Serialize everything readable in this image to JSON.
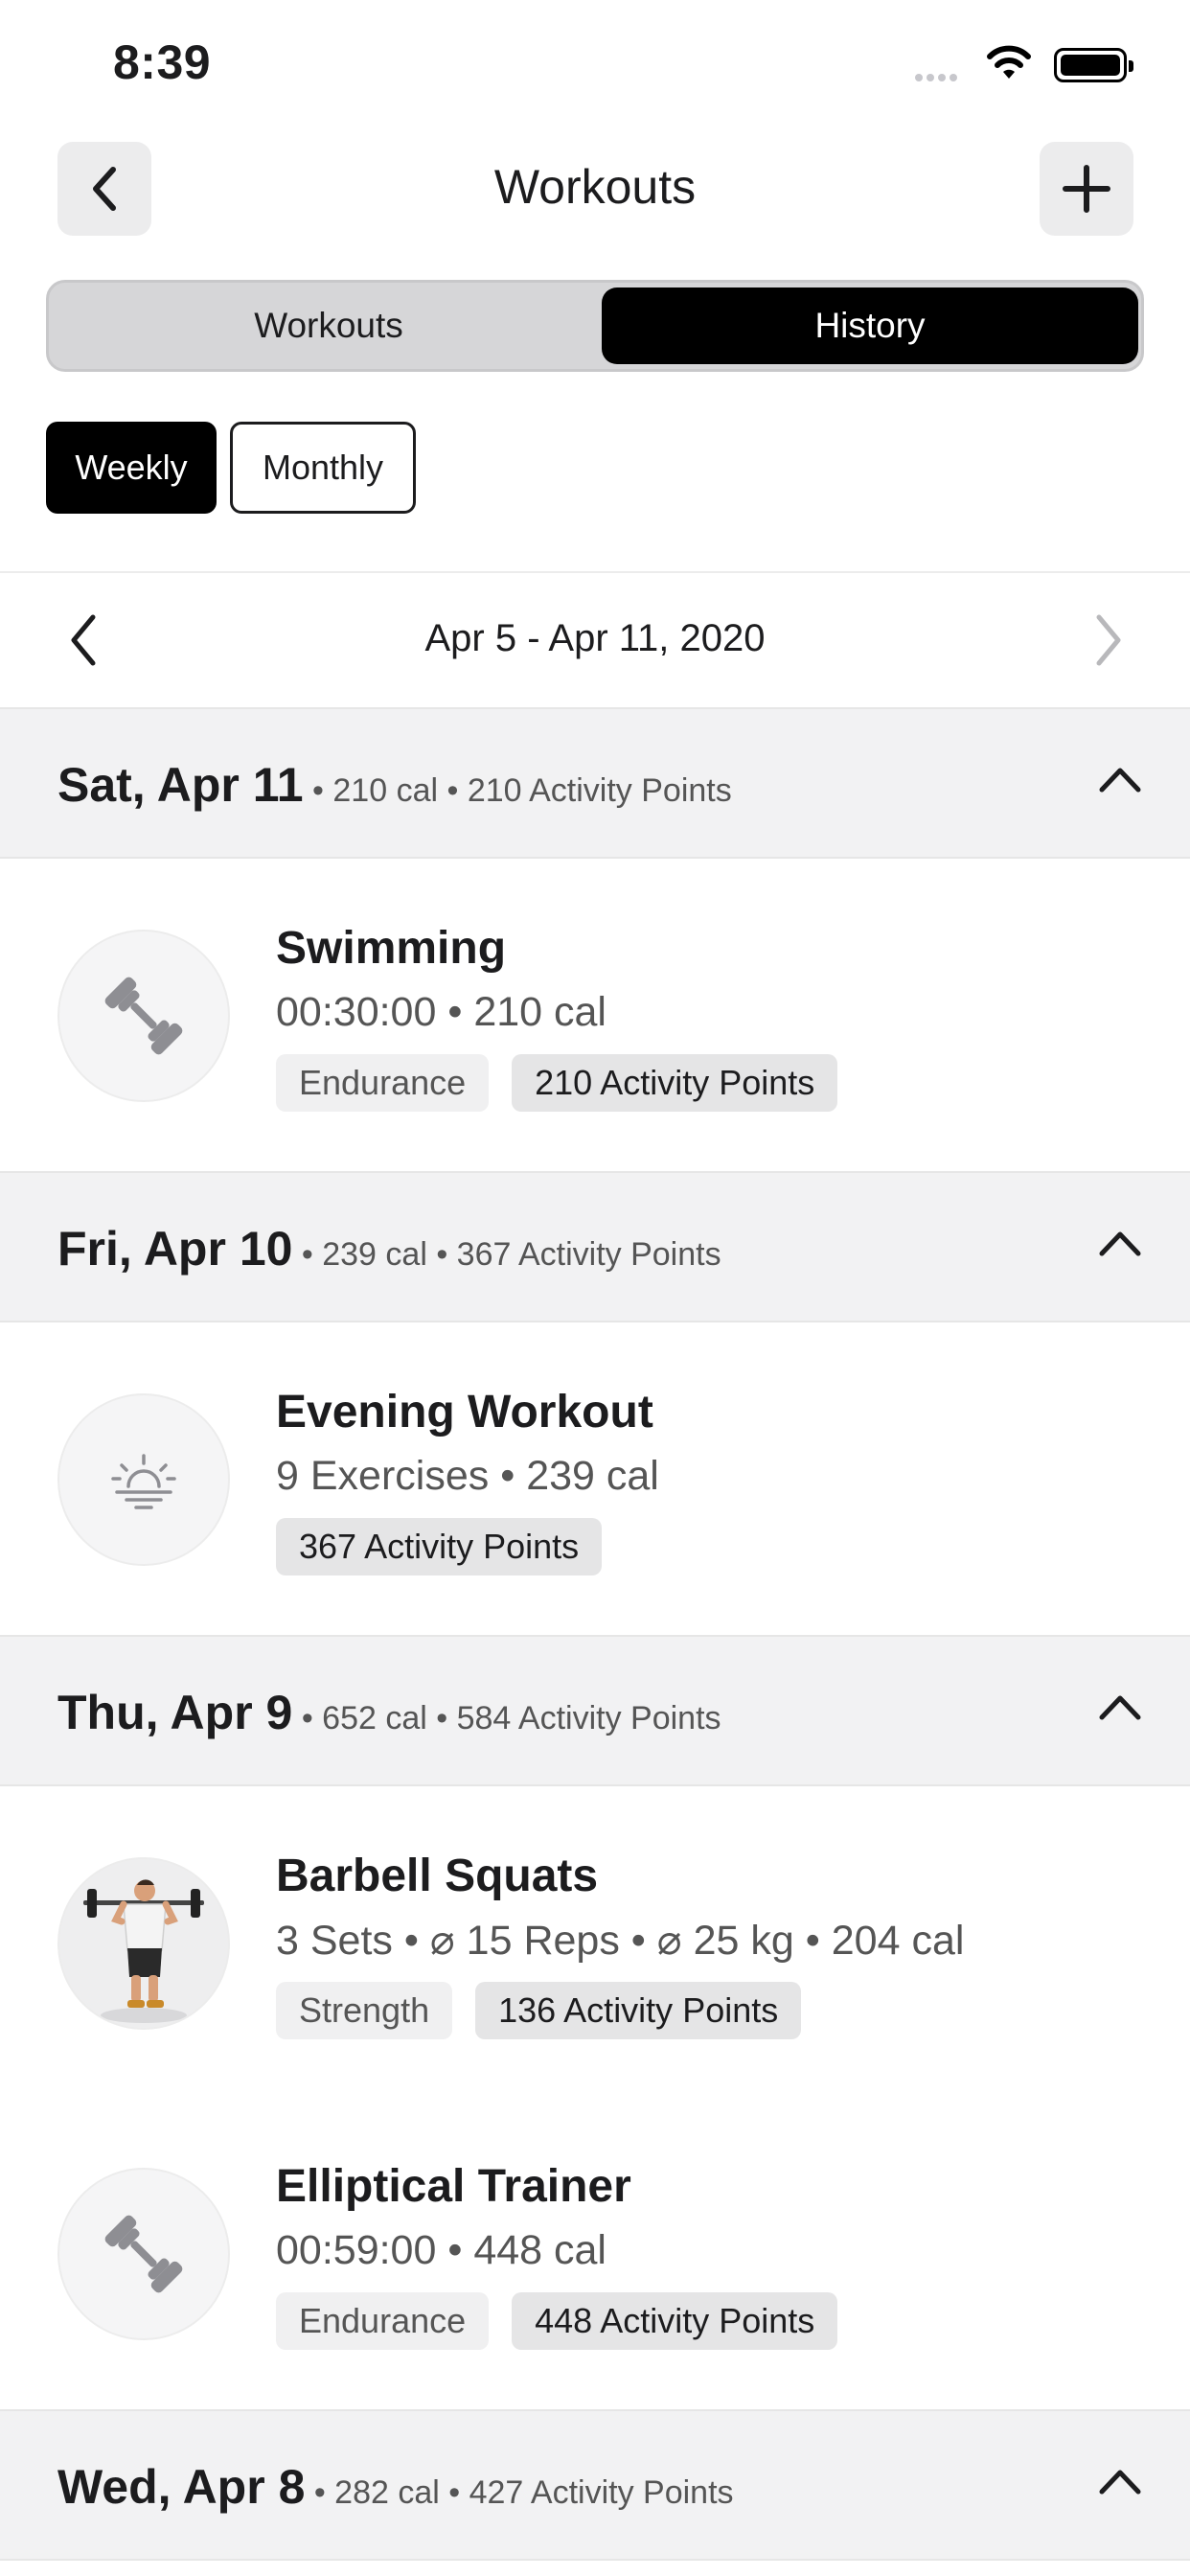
{
  "status_bar": {
    "time": "8:39"
  },
  "nav": {
    "title": "Workouts",
    "back_icon": "chevron-left-icon",
    "add_icon": "plus-icon"
  },
  "segments": {
    "workouts": "Workouts",
    "history": "History",
    "selected": "History"
  },
  "period": {
    "weekly": "Weekly",
    "monthly": "Monthly",
    "selected": "Weekly"
  },
  "range": {
    "label": "Apr 5 - Apr 11, 2020"
  },
  "days": [
    {
      "title": "Sat, Apr 11",
      "meta": " • 210 cal • 210 Activity Points",
      "workouts": [
        {
          "name": "Swimming",
          "stats": "00:30:00 • 210 cal",
          "type": "Endurance",
          "points": "210 Activity Points",
          "icon": "dumbbell-icon"
        }
      ]
    },
    {
      "title": "Fri, Apr 10",
      "meta": " • 239 cal • 367 Activity Points",
      "workouts": [
        {
          "name": "Evening Workout",
          "stats": "9 Exercises • 239 cal",
          "type": "",
          "points": "367 Activity Points",
          "icon": "sunset-icon"
        }
      ]
    },
    {
      "title": "Thu, Apr 9",
      "meta": " • 652 cal • 584 Activity Points",
      "workouts": [
        {
          "name": "Barbell Squats",
          "stats": "3 Sets • ⌀ 15 Reps • ⌀ 25 kg • 204 cal",
          "type": "Strength",
          "points": "136 Activity Points",
          "icon": "barbell-squat-figure"
        },
        {
          "name": "Elliptical Trainer",
          "stats": "00:59:00 • 448 cal",
          "type": "Endurance",
          "points": "448 Activity Points",
          "icon": "dumbbell-icon"
        }
      ]
    },
    {
      "title": "Wed, Apr 8",
      "meta": " • 282 cal • 427 Activity Points",
      "workouts": []
    }
  ]
}
